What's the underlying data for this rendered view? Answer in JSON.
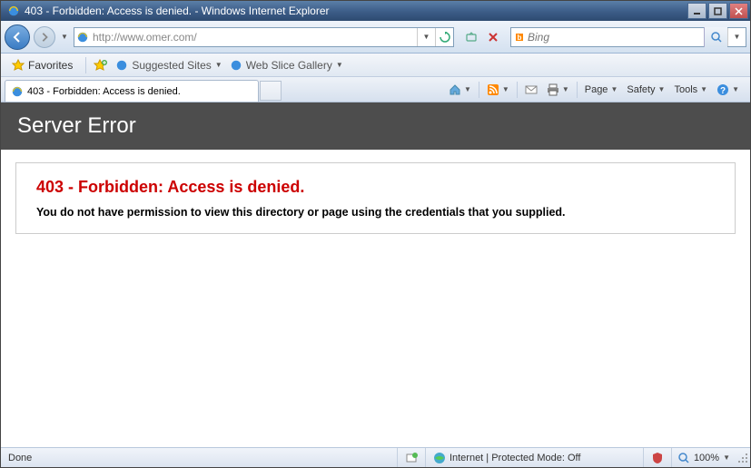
{
  "window": {
    "title": "403 - Forbidden: Access is denied. - Windows Internet Explorer"
  },
  "address": {
    "url": "http://www.omer.com/"
  },
  "search": {
    "placeholder": "Bing"
  },
  "favorites": {
    "button": "Favorites",
    "suggested": "Suggested Sites",
    "gallery": "Web Slice Gallery"
  },
  "tab": {
    "title": "403 - Forbidden: Access is denied."
  },
  "commands": {
    "page": "Page",
    "safety": "Safety",
    "tools": "Tools"
  },
  "error": {
    "server_header": "Server Error",
    "title": "403 - Forbidden: Access is denied.",
    "message": "You do not have permission to view this directory or page using the credentials that you supplied."
  },
  "status": {
    "left": "Done",
    "zone": "Internet | Protected Mode: Off",
    "zoom": "100%"
  }
}
